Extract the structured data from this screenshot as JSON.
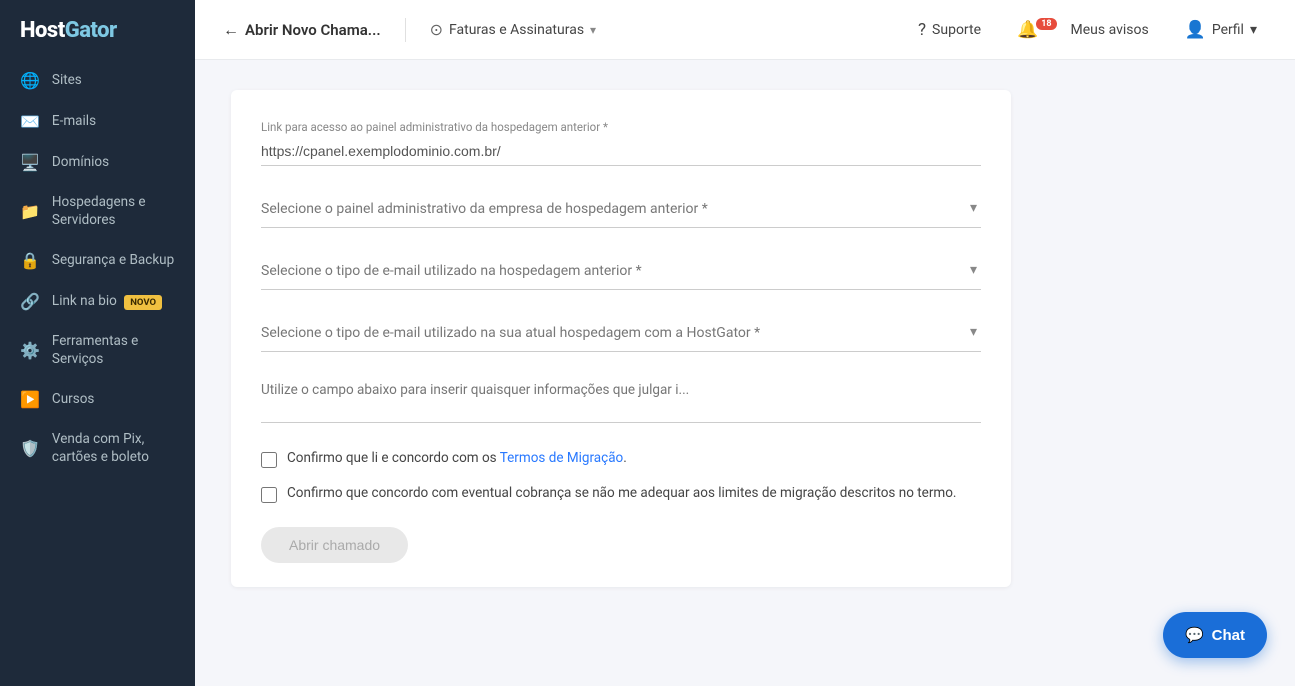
{
  "sidebar": {
    "logo": "HostGator",
    "items": [
      {
        "id": "sites",
        "label": "Sites",
        "icon": "🌐"
      },
      {
        "id": "emails",
        "label": "E-mails",
        "icon": "✉️"
      },
      {
        "id": "dominios",
        "label": "Domínios",
        "icon": "🖥️"
      },
      {
        "id": "hospedagens",
        "label": "Hospedagens e Servidores",
        "icon": "📁"
      },
      {
        "id": "seguranca",
        "label": "Segurança e Backup",
        "icon": "🔒"
      },
      {
        "id": "link-bio",
        "label": "Link na bio",
        "icon": "🔗",
        "badge": "NOVO"
      },
      {
        "id": "ferramentas",
        "label": "Ferramentas e Serviços",
        "icon": "⚙️"
      },
      {
        "id": "cursos",
        "label": "Cursos",
        "icon": "▶️"
      },
      {
        "id": "pix",
        "label": "Venda com Pix, cartões e boleto",
        "icon": "🛡️"
      }
    ]
  },
  "topbar": {
    "back_label": "Abrir Novo Chama...",
    "section_label": "Faturas e Assinaturas",
    "support_label": "Suporte",
    "notifications_label": "Meus avisos",
    "notifications_count": "18",
    "profile_label": "Perfil"
  },
  "form": {
    "admin_link_label": "Link para acesso ao painel administrativo da hospedagem anterior *",
    "admin_link_placeholder": "https://cpanel.exemplodominio.com.br/",
    "admin_link_value": "https://cpanel.exemplodominio.com.br/",
    "select_panel_label": "Selecione o painel administrativo da empresa de hospedagem anterior *",
    "select_email_prev_label": "Selecione o tipo de e-mail utilizado na hospedagem anterior *",
    "select_email_curr_label": "Selecione o tipo de e-mail utilizado na sua atual hospedagem com a HostGator *",
    "textarea_placeholder": "Utilize o campo abaixo para inserir quaisquer informações que julgar i...",
    "checkbox1_text": "Confirmo que li e concordo com os Termos de Migração.",
    "checkbox1_link_text": "Termos de Migração",
    "checkbox2_text": "Confirmo que concordo com eventual cobrança se não me adequar aos limites de migração descritos no termo.",
    "submit_label": "Abrir chamado"
  },
  "chat": {
    "label": "Chat",
    "icon": "💬"
  }
}
